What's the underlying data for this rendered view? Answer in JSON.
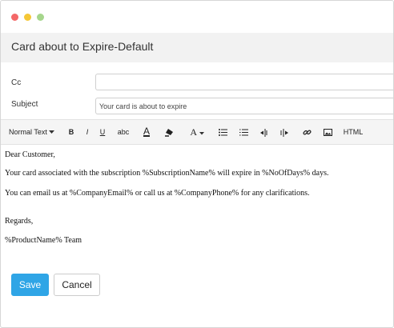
{
  "window": {
    "title": "Card about to Expire-Default"
  },
  "form": {
    "cc_label": "Cc",
    "cc_value": "",
    "subject_label": "Subject",
    "subject_value": "Your card is about to expire"
  },
  "toolbar": {
    "format_label": "Normal Text",
    "bold_label": "B",
    "italic_label": "I",
    "underline_label": "U",
    "strike_label": "abc",
    "font_color_label": "A",
    "font_size_label": "A",
    "html_label": "HTML",
    "icons": [
      "chevron-down-icon",
      "font-color-icon",
      "highlight-icon",
      "font-size-icon",
      "bulleted-list-icon",
      "numbered-list-icon",
      "outdent-icon",
      "indent-icon",
      "link-icon",
      "image-icon"
    ]
  },
  "editor": {
    "greeting": "Dear Customer,",
    "line1": "Your card associated with the subscription %SubscriptionName% will expire in %NoOfDays% days.",
    "line2": "You can email us at %CompanyEmail% or call us at %CompanyPhone% for any clarifications.",
    "closing": "Regards,",
    "signature": "%ProductName% Team"
  },
  "actions": {
    "save_label": "Save",
    "cancel_label": "Cancel"
  },
  "colors": {
    "primary": "#2fa5e6",
    "header_bg": "#f2f2f2",
    "toolbar_bg": "#f5f5f5",
    "dot_red": "#f46868",
    "dot_yellow": "#f5c736",
    "dot_green": "#a6d68c"
  }
}
